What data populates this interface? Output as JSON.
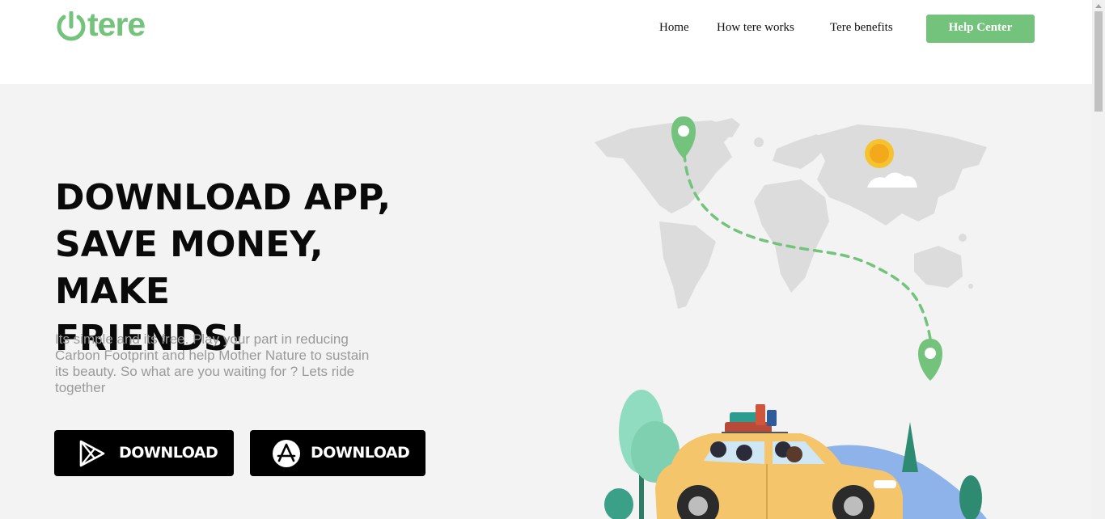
{
  "header": {
    "logo": "tere",
    "nav": [
      "Home",
      "How tere works",
      "Tere benefits"
    ],
    "help_button": "Help Center"
  },
  "hero": {
    "headline_lines": [
      "DOWNLOAD APP,",
      "SAVE MONEY, MAKE",
      "FRIENDS!"
    ],
    "subtitle": "Its simple and its free. Play your part in reducing Carbon Footprint and help Mother Nature to sustain its beauty. So what are you waiting for ? Lets ride together",
    "buttons": [
      {
        "label": "DOWNLOAD",
        "icon": "google-play-icon"
      },
      {
        "label": "DOWNLOAD",
        "icon": "app-store-icon"
      }
    ]
  },
  "colors": {
    "brand_green": "#73c37c",
    "hero_bg": "#f3f3f3",
    "button_bg": "#000000",
    "subtitle_text": "#9a9a9a"
  }
}
